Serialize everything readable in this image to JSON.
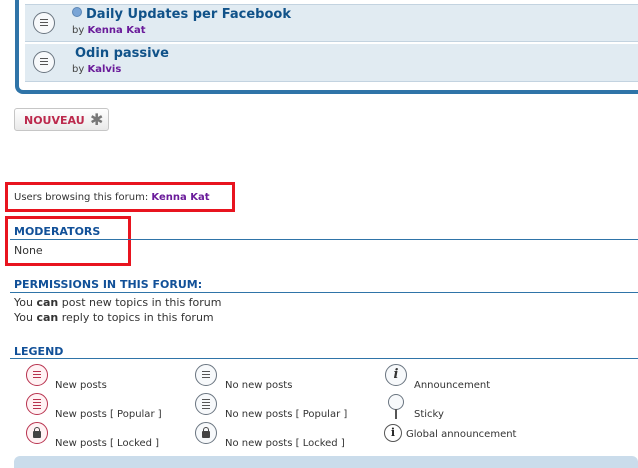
{
  "topics": [
    {
      "title": "Daily Updates per Facebook",
      "by_prefix": "by",
      "author": "Kenna Kat"
    },
    {
      "title": "Odin passive",
      "by_prefix": "by",
      "author": "Kalvis"
    }
  ],
  "new_button": {
    "label": "NOUVEAU",
    "icon": "star-icon"
  },
  "browsing": {
    "prefix": "Users browsing this forum:",
    "user": "Kenna Kat"
  },
  "moderators": {
    "heading": "MODERATORS",
    "value": "None"
  },
  "permissions": {
    "heading": "PERMISSIONS IN THIS FORUM:",
    "lines": [
      {
        "pre": "You ",
        "bold": "can",
        "post": " post new topics in this forum"
      },
      {
        "pre": "You ",
        "bold": "can",
        "post": " reply to topics in this forum"
      }
    ]
  },
  "legend": {
    "heading": "LEGEND",
    "col1": [
      "New posts",
      "New posts [ Popular ]",
      "New posts [ Locked ]"
    ],
    "col2": [
      "No new posts",
      "No new posts [ Popular ]",
      "No new posts [ Locked ]"
    ],
    "col3": [
      "Announcement",
      "Sticky",
      "Global announcement"
    ]
  },
  "colors": {
    "accent": "#2f74a8",
    "highlight_box": "#e8141f",
    "username": "#6a1b9a",
    "button_text": "#bc2a4d"
  }
}
